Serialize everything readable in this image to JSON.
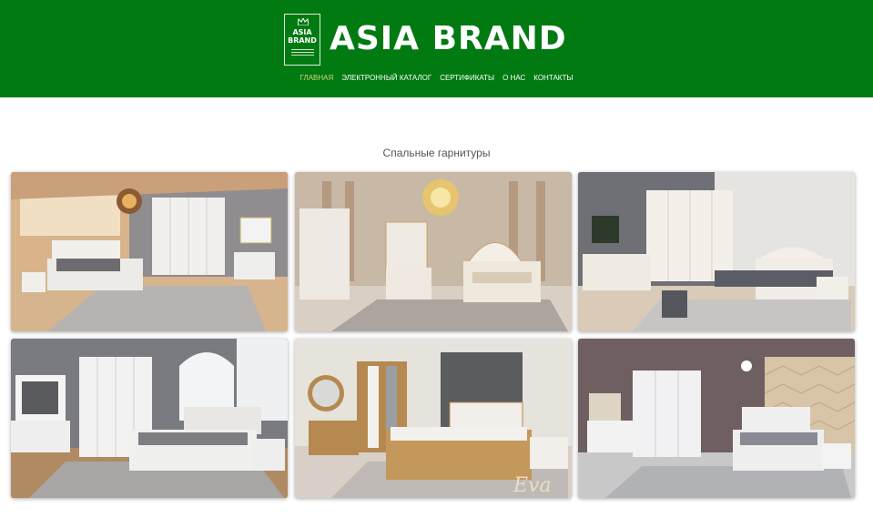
{
  "header": {
    "logo_line1": "ASIA",
    "logo_line2": "BRAND",
    "brand_name": "ASIA BRAND",
    "bg_color": "#007a11"
  },
  "nav": {
    "items": [
      {
        "label": "ГЛАВНАЯ",
        "active": true
      },
      {
        "label": "ЭЛЕКТРОННЫЙ КАТАЛОГ",
        "active": false
      },
      {
        "label": "СЕРТИФИКАТЫ",
        "active": false
      },
      {
        "label": "О НАС",
        "active": false
      },
      {
        "label": "КОНТАКТЫ",
        "active": false
      }
    ],
    "active_color": "#d8d27a"
  },
  "section": {
    "title": "Спальные гарнитуры"
  },
  "gallery": {
    "cards": [
      {
        "id": "bedroom-1"
      },
      {
        "id": "bedroom-2"
      },
      {
        "id": "bedroom-3"
      },
      {
        "id": "bedroom-4"
      },
      {
        "id": "bedroom-5",
        "watermark": "Eva"
      },
      {
        "id": "bedroom-6"
      }
    ]
  }
}
